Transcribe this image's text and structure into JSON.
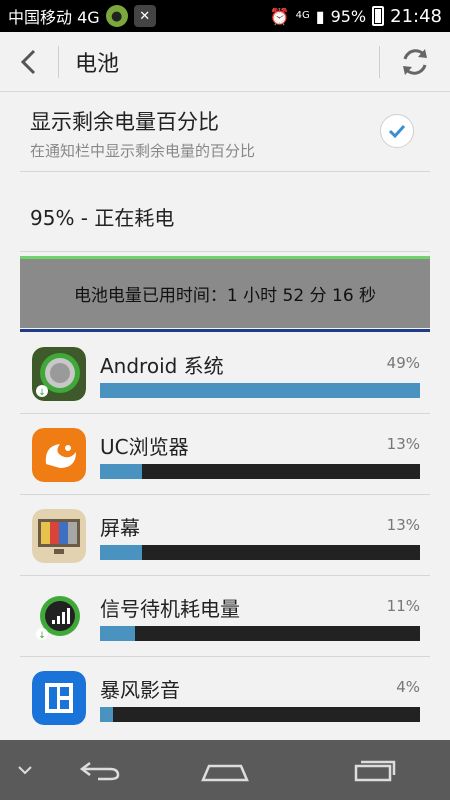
{
  "status_bar": {
    "carrier": "中国移动 4G",
    "network": "4G",
    "battery": "95%",
    "time": "21:48",
    "icons": [
      "notification-app-icon",
      "tool-icon",
      "alarm-icon",
      "signal-icon",
      "battery-icon"
    ]
  },
  "header": {
    "title": "电池"
  },
  "setting": {
    "title": "显示剩余电量百分比",
    "subtitle": "在通知栏中显示剩余电量的百分比",
    "checked": true
  },
  "status": {
    "text": "95% - 正在耗电"
  },
  "usage": {
    "text": "电池电量已用时间：1 小时 52 分 16 秒",
    "accent": "#6fd36b",
    "line_color": "#1f3c8a"
  },
  "apps": [
    {
      "name": "Android 系统",
      "percent": "49%",
      "value": 49,
      "icon": "android-system-icon"
    },
    {
      "name": "UC浏览器",
      "percent": "13%",
      "value": 13,
      "icon": "uc-browser-icon"
    },
    {
      "name": "屏幕",
      "percent": "13%",
      "value": 13,
      "icon": "screen-icon"
    },
    {
      "name": "信号待机耗电量",
      "percent": "11%",
      "value": 11,
      "icon": "signal-standby-icon"
    },
    {
      "name": "暴风影音",
      "percent": "4%",
      "value": 4,
      "icon": "baofeng-icon"
    }
  ],
  "colors": {
    "bar_fill": "#4a93c1",
    "bar_bg": "#222222",
    "nav_bg": "#5a5a5a"
  }
}
